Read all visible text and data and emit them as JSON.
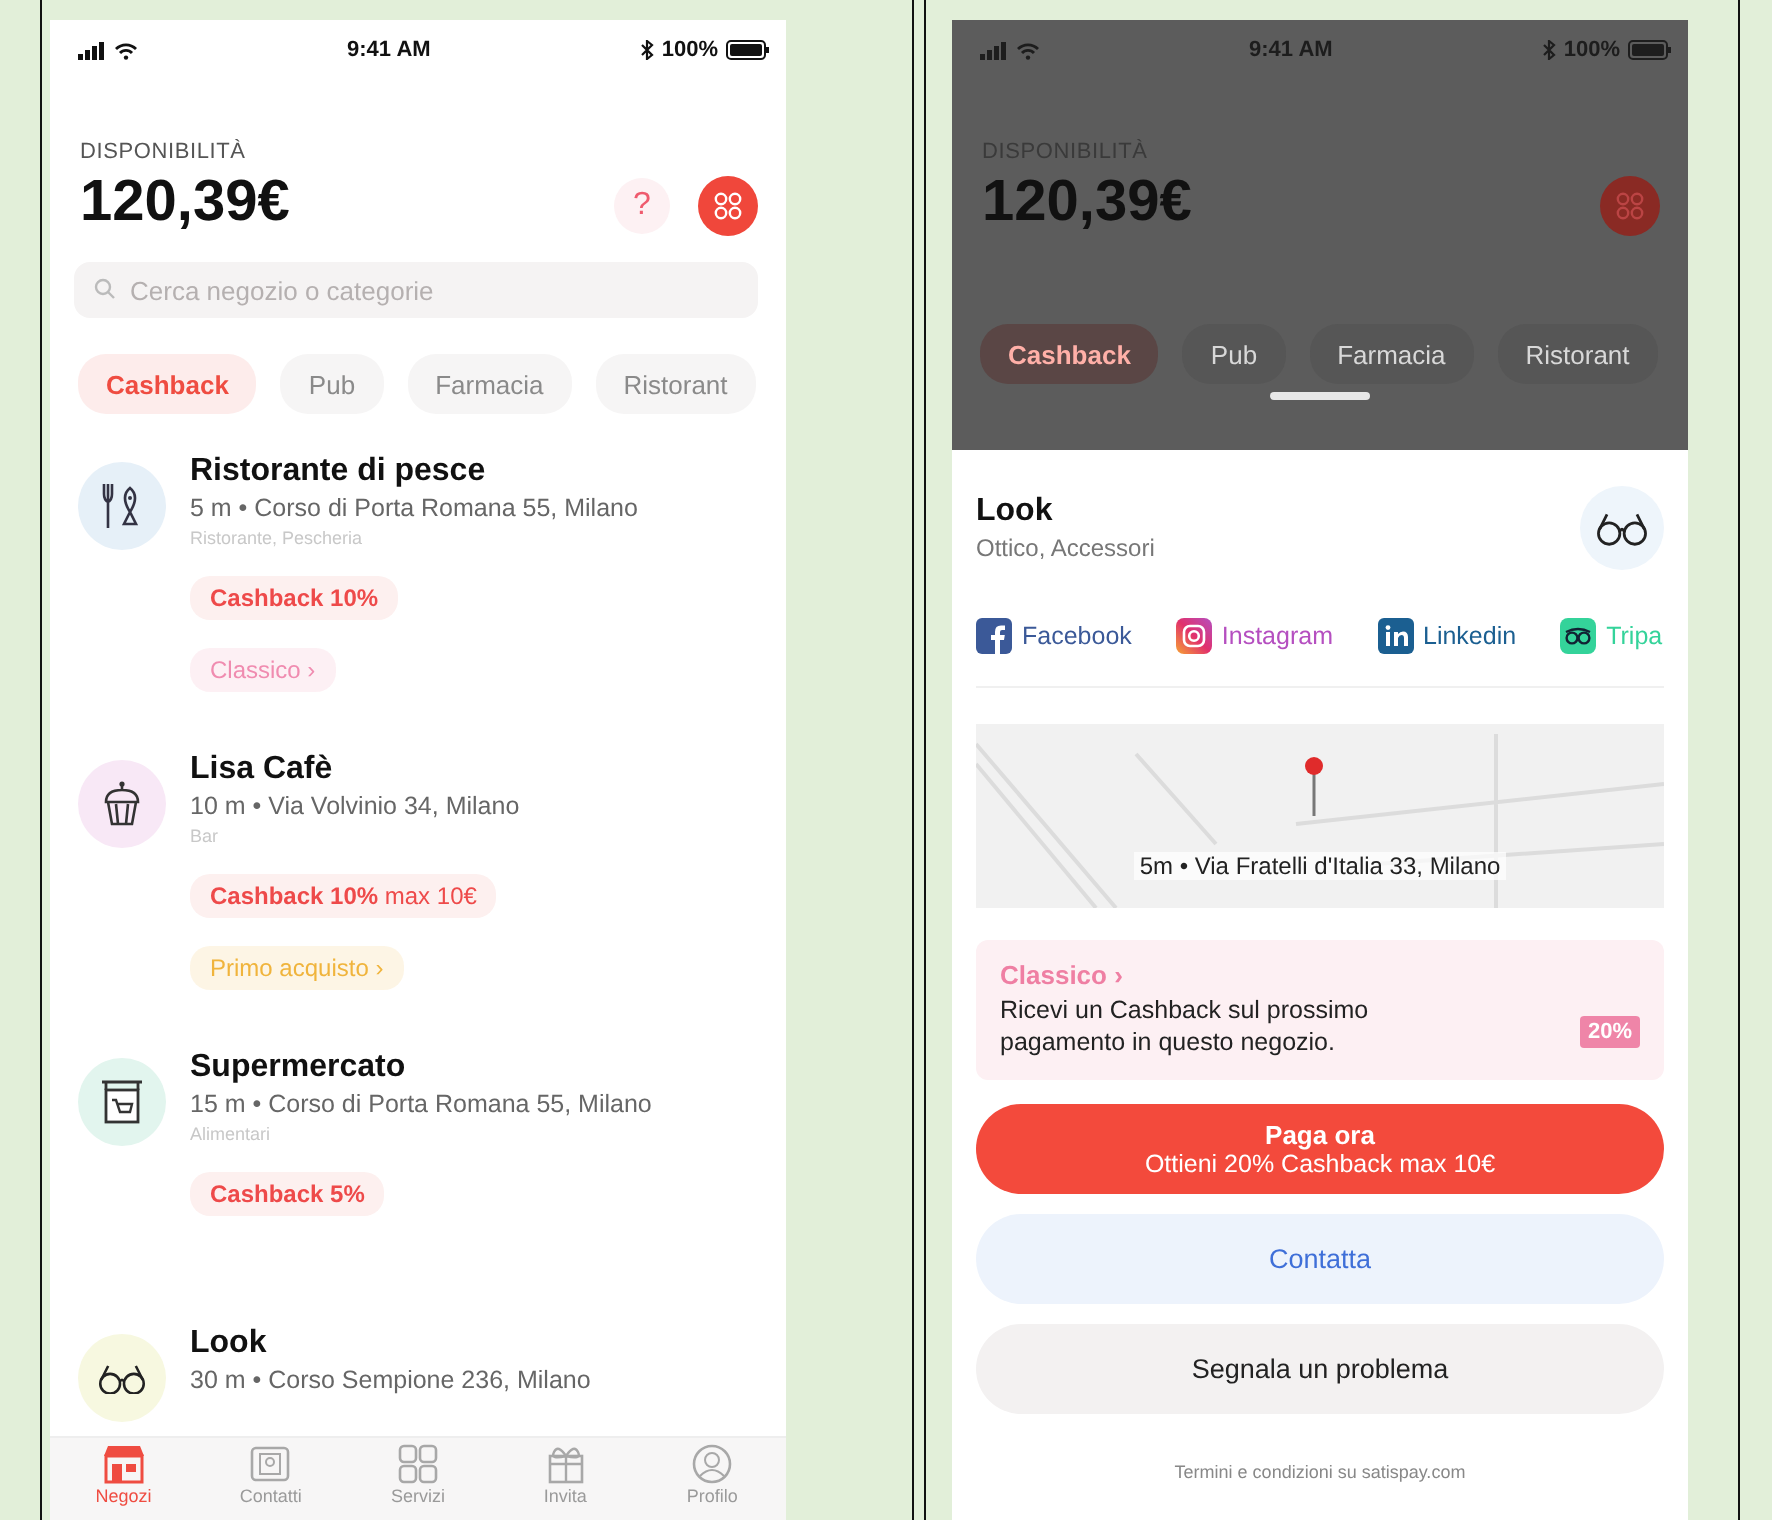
{
  "left_phone": {
    "status_bar": {
      "time": "9:41 AM",
      "battery": "100%"
    },
    "balance": {
      "label": "DISPONIBILITÀ",
      "amount": "120,39€"
    },
    "help_button": "?",
    "search": {
      "placeholder": "Cerca negozio o categorie"
    },
    "chips": [
      {
        "label": "Cashback",
        "selected": true
      },
      {
        "label": "Pub",
        "selected": false
      },
      {
        "label": "Farmacia",
        "selected": false
      },
      {
        "label": "Ristorant",
        "selected": false
      }
    ],
    "stores": [
      {
        "name": "Ristorante di pesce",
        "address": "5 m • Corso di Porta Romana 55, Milano",
        "category": "Ristorante, Pescheria",
        "color": "#e6f0f8",
        "tags": [
          {
            "kind": "cashback",
            "label": "Cashback 10%"
          },
          {
            "kind": "program",
            "label": "Classico ›",
            "color": "#f08cb0"
          }
        ]
      },
      {
        "name": "Lisa Cafè",
        "address": "10 m • Via Volvinio 34, Milano",
        "category": "Bar",
        "color": "#f8e8f6",
        "tags": [
          {
            "kind": "cashback",
            "label": "Cashback 10%",
            "cap": "max 10€"
          },
          {
            "kind": "program",
            "label": "Primo acquisto ›",
            "color": "#f0b43c"
          }
        ]
      },
      {
        "name": "Supermercato",
        "address": "15 m • Corso di Porta Romana 55, Milano",
        "category": "Alimentari",
        "color": "#e2f5ee",
        "tags": [
          {
            "kind": "cashback",
            "label": "Cashback 5%"
          }
        ]
      },
      {
        "name": "Look",
        "address": "30 m • Corso Sempione 236, Milano",
        "color": "#f7f8e0"
      }
    ],
    "tab_bar": [
      {
        "label": "Negozi",
        "selected": true
      },
      {
        "label": "Contatti",
        "selected": false
      },
      {
        "label": "Servizi",
        "selected": false
      },
      {
        "label": "Invita",
        "selected": false
      },
      {
        "label": "Profilo",
        "selected": false
      }
    ]
  },
  "right_phone": {
    "backdrop": {
      "status_bar": {
        "time": "9:41 AM",
        "battery": "100%"
      },
      "balance": {
        "label": "DISPONIBILITÀ",
        "amount": "120,39€"
      },
      "chips": [
        {
          "label": "Cashback",
          "selected": true
        },
        {
          "label": "Pub",
          "selected": false
        },
        {
          "label": "Farmacia",
          "selected": false
        },
        {
          "label": "Ristorant",
          "selected": false
        }
      ]
    },
    "sheet": {
      "title": "Look",
      "subtitle": "Ottico, Accessori",
      "socials": [
        {
          "label": "Facebook",
          "color": "#3b5998"
        },
        {
          "label": "Instagram",
          "color": "#b54fc0"
        },
        {
          "label": "Linkedin",
          "color": "#1b5f91"
        },
        {
          "label": "Tripa",
          "color": "#34d39a"
        }
      ],
      "map": {
        "address": "5m • Via Fratelli d'Italia 33, Milano"
      },
      "program": {
        "title": "Classico ›",
        "description": "Ricevi un Cashback sul prossimo pagamento in questo negozio.",
        "badge": "20%"
      },
      "pay_button": {
        "label": "Paga ora",
        "detail": "Ottieni 20% Cashback max 10€"
      },
      "contact_button": "Contatta",
      "report_button": "Segnala un problema",
      "footer": "Termini e condizioni su satispay.com"
    }
  }
}
